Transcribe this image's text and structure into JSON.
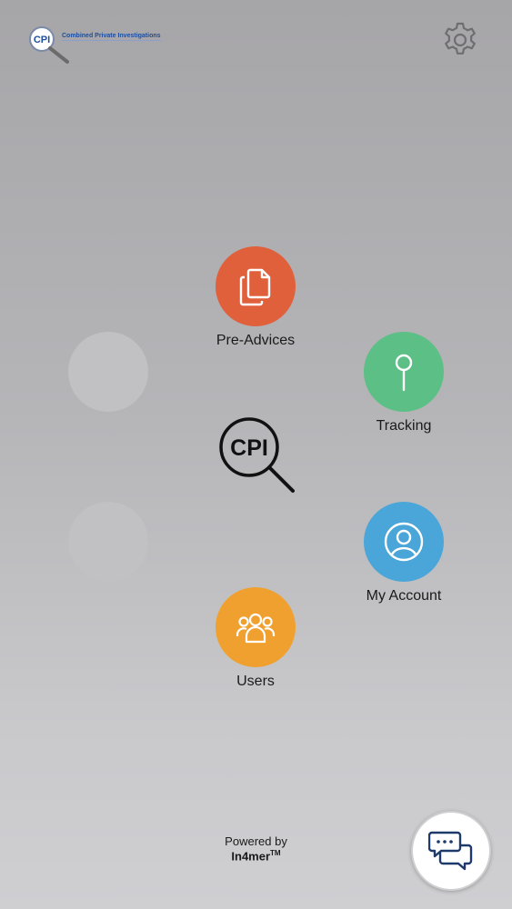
{
  "header": {
    "logo_badge": "CPI",
    "logo_text": "Combined Private Investigations"
  },
  "center": {
    "logo_text": "CPI"
  },
  "menu": {
    "pre_advices": {
      "label": "Pre-Advices",
      "color": "#e0603c",
      "icon": "documents-icon"
    },
    "tracking": {
      "label": "Tracking",
      "color": "#5cbf86",
      "icon": "map-pin-icon"
    },
    "my_account": {
      "label": "My Account",
      "color": "#4aa6d8",
      "icon": "user-circle-icon"
    },
    "users": {
      "label": "Users",
      "color": "#f0a02e",
      "icon": "users-group-icon"
    }
  },
  "footer": {
    "powered_by": "Powered by",
    "brand": "In4mer",
    "trademark": "TM"
  }
}
